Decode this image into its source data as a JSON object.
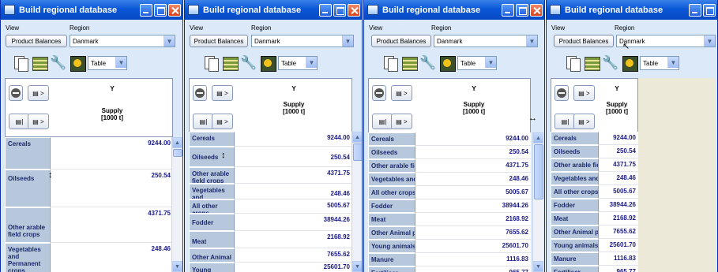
{
  "windows": [
    {
      "title": "Build regional database"
    },
    {
      "title": "Build regional database"
    },
    {
      "title": "Build regional database"
    },
    {
      "title": "Build regional database"
    }
  ],
  "labels": {
    "view": "View",
    "region": "Region"
  },
  "view_button": "Product Balances",
  "region_value": "Danmark",
  "display_value": "Table",
  "col_header": "Y",
  "col_header_desc": "Supply",
  "col_header_unit": "[1000 t]",
  "toolbar_icons": [
    "pages-icon",
    "flow-diagram-icon",
    "wrench-icon",
    "chart-settings-icon"
  ],
  "rows": [
    {
      "label": "Cereals",
      "value": "9244.00"
    },
    {
      "label": "Oilseeds",
      "value": "250.54"
    },
    {
      "label": "Other arable field crops",
      "value": "4371.75"
    },
    {
      "label": "Vegetables and Permanent crops",
      "value": "248.46"
    },
    {
      "label": "All other crops",
      "value": "5005.67"
    },
    {
      "label": "Fodder",
      "value": "38944.26"
    },
    {
      "label": "Meat",
      "value": "2168.92"
    },
    {
      "label": "Other Animal products",
      "value": "7655.62"
    },
    {
      "label": "Young animals",
      "value": "25601.70"
    },
    {
      "label": "Manure",
      "value": "1116.83"
    },
    {
      "label": "Fertiliser",
      "value": "965.77"
    }
  ],
  "colors": {
    "titlebar": "#0a57d8",
    "panel": "#dce9f8",
    "row_header": "#b8c8dc",
    "value_text": "#1a1a8a"
  }
}
